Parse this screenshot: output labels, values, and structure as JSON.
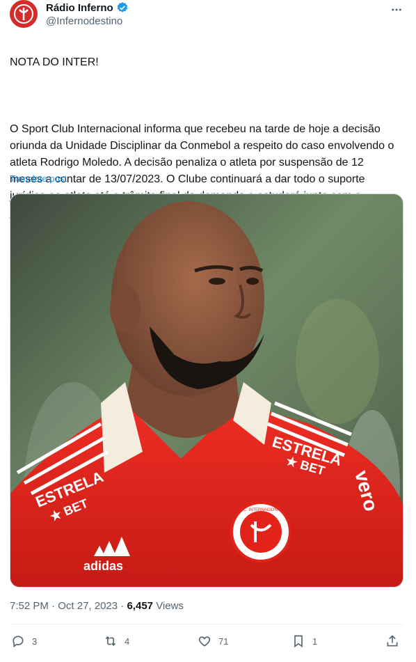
{
  "author": {
    "name": "Rádio Inferno",
    "handle": "@Infernodestino",
    "avatar_color": "#d62b2b",
    "verified_color": "#1d9bf0"
  },
  "tweet": {
    "headline": "NOTA DO INTER!",
    "body": "O Sport Club Internacional informa que recebeu na tarde de hoje a decisão oriunda da Unidade Disciplinar da Conmebol a respeito do caso envolvendo o atleta Rodrigo Moledo. A decisão penaliza o atleta por suspensão de 12 meses a contar de 13/07/2023. O Clube continuará a dar todo o suporte jurídico ao atleta até o trâmite final da demanda e estudará junto com o jogador as medidas recursais pertinentes.",
    "translate_label": "Translate post"
  },
  "media": {
    "jersey_color": "#e2231a",
    "sponsor_text": "ESTRELA\n★ BET",
    "brand_text": "adidas",
    "side_text": "vero",
    "crest_text": "S.C. INTERNACIONAL"
  },
  "meta": {
    "time": "7:52 PM",
    "separator": "·",
    "date": "Oct 27, 2023",
    "views_count": "6,457",
    "views_label": "Views"
  },
  "actions": {
    "replies": "3",
    "reposts": "4",
    "likes": "71",
    "bookmarks": "1"
  }
}
